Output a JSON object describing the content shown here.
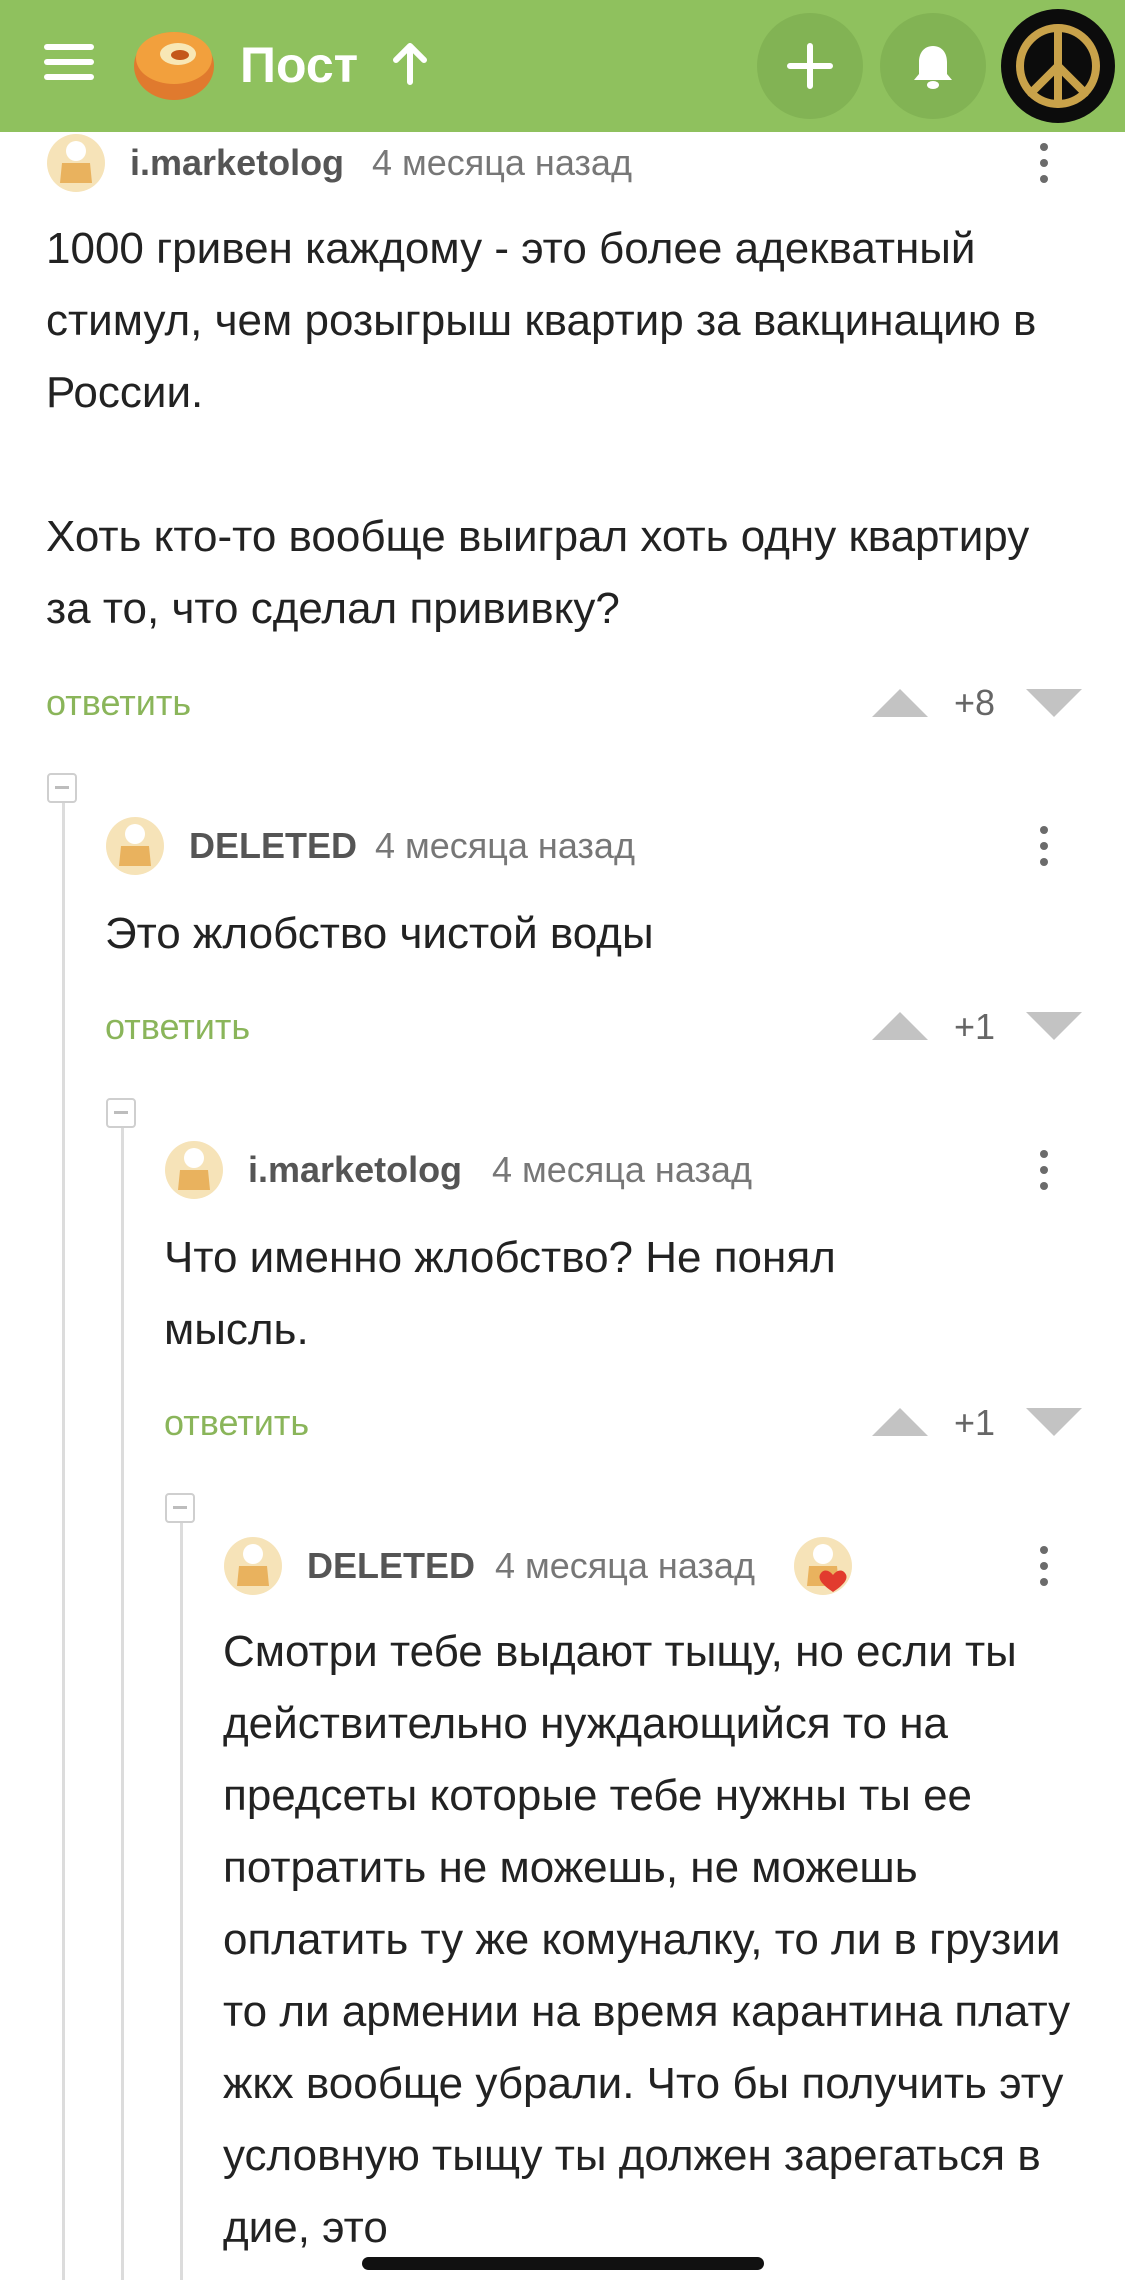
{
  "header": {
    "title": "Пост",
    "menu_icon": "hamburger-menu-icon",
    "logo_icon": "pikabu-logo-icon",
    "scroll_up_icon": "arrow-up-icon",
    "add_icon": "plus-icon",
    "notifications_icon": "bell-icon",
    "avatar_icon": "peace-symbol-icon",
    "bar_color": "#8fc15e"
  },
  "comments": [
    {
      "author": "i.marketolog",
      "time": "4 месяца назад",
      "text": "1000 гривен каждому - это более адекватный стимул, чем розыгрыш квартир за вакцинацию в России.\n\nХоть кто-то вообще выиграл хоть одну квартиру за то, что сделал прививку?",
      "reply_label": "ответить",
      "score": "+8"
    },
    {
      "author": "DELETED",
      "time": "4 месяца назад",
      "text": "Это жлобство чистой воды",
      "reply_label": "ответить",
      "score": "+1"
    },
    {
      "author": "i.marketolog",
      "time": "4 месяца назад",
      "text": "Что именно жлобство? Не понял мысль.",
      "reply_label": "ответить",
      "score": "+1"
    },
    {
      "author": "DELETED",
      "time": "4 месяца назад",
      "text": "Смотри тебе выдают тыщу, но если ты действительно нуждающийся то на предсеты которые тебе нужны ты ее потратить не можешь, не можешь оплатить ту же комуналку, то ли в грузии то ли армении на время карантина плату жкх вообще убрали. Что бы получить эту условную тыщу ты должен зарегаться в дие, это",
      "badge_icon": "heart-badge-icon"
    }
  ],
  "colors": {
    "accent_green": "#8fc15e",
    "reply_link": "#8ab55a",
    "vote_arrow": "#c3c3c3"
  }
}
